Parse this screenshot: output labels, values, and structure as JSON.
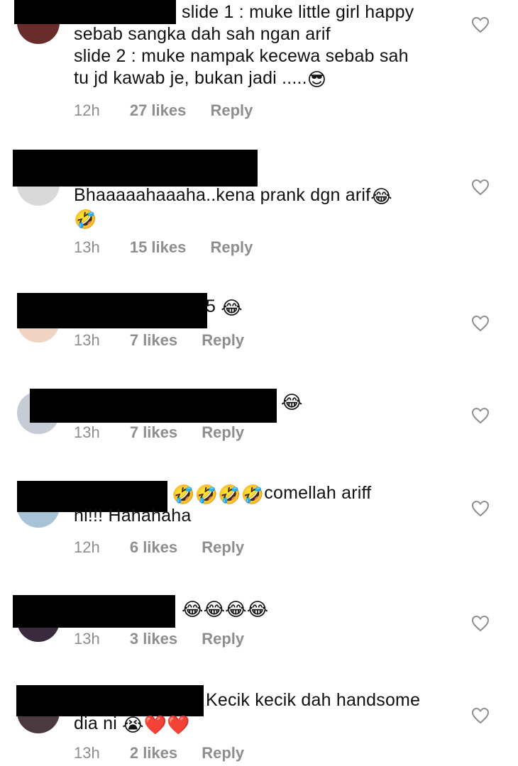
{
  "comments": [
    {
      "lines": [
        "slide 1 : muke little girl happy",
        "sebab sangka dah sah ngan arif",
        "slide 2 : muke nampak kecewa sebab sah",
        "tu jd kawab je, bukan jadi ....."
      ],
      "emoji_after_last": "😎",
      "time": "12h",
      "likes": "27 likes",
      "reply": "Reply"
    },
    {
      "lines": [
        "Bhaaaaahaaaha..kena prank dgn arif"
      ],
      "emoji_after_first": "😂",
      "second_line_emoji": "🤣",
      "time": "13h",
      "likes": "15 likes",
      "reply": "Reply"
    },
    {
      "suffix": "5",
      "emoji": "😂",
      "time": "13h",
      "likes": "7 likes",
      "reply": "Reply"
    },
    {
      "emoji": "😂",
      "time": "13h",
      "likes": "7 likes",
      "reply": "Reply"
    },
    {
      "emojis": "🤣🤣🤣🤣",
      "text": "comellah ariff",
      "line2": "ni!!! Hahahaha",
      "time": "12h",
      "likes": "6 likes",
      "reply": "Reply"
    },
    {
      "emojis": "😂😂😂😂",
      "time": "13h",
      "likes": "3 likes",
      "reply": "Reply"
    },
    {
      "text": "Kecik kecik dah handsome",
      "line2": "dia ni",
      "line2_emojis": "😭❤️❤️",
      "time": "13h",
      "likes": "2 likes",
      "reply": "Reply"
    }
  ],
  "icons": {
    "like": "heart-outline-icon"
  },
  "colors": {
    "text": "#111111",
    "meta": "#8e8e8e",
    "redaction": "#000000"
  }
}
